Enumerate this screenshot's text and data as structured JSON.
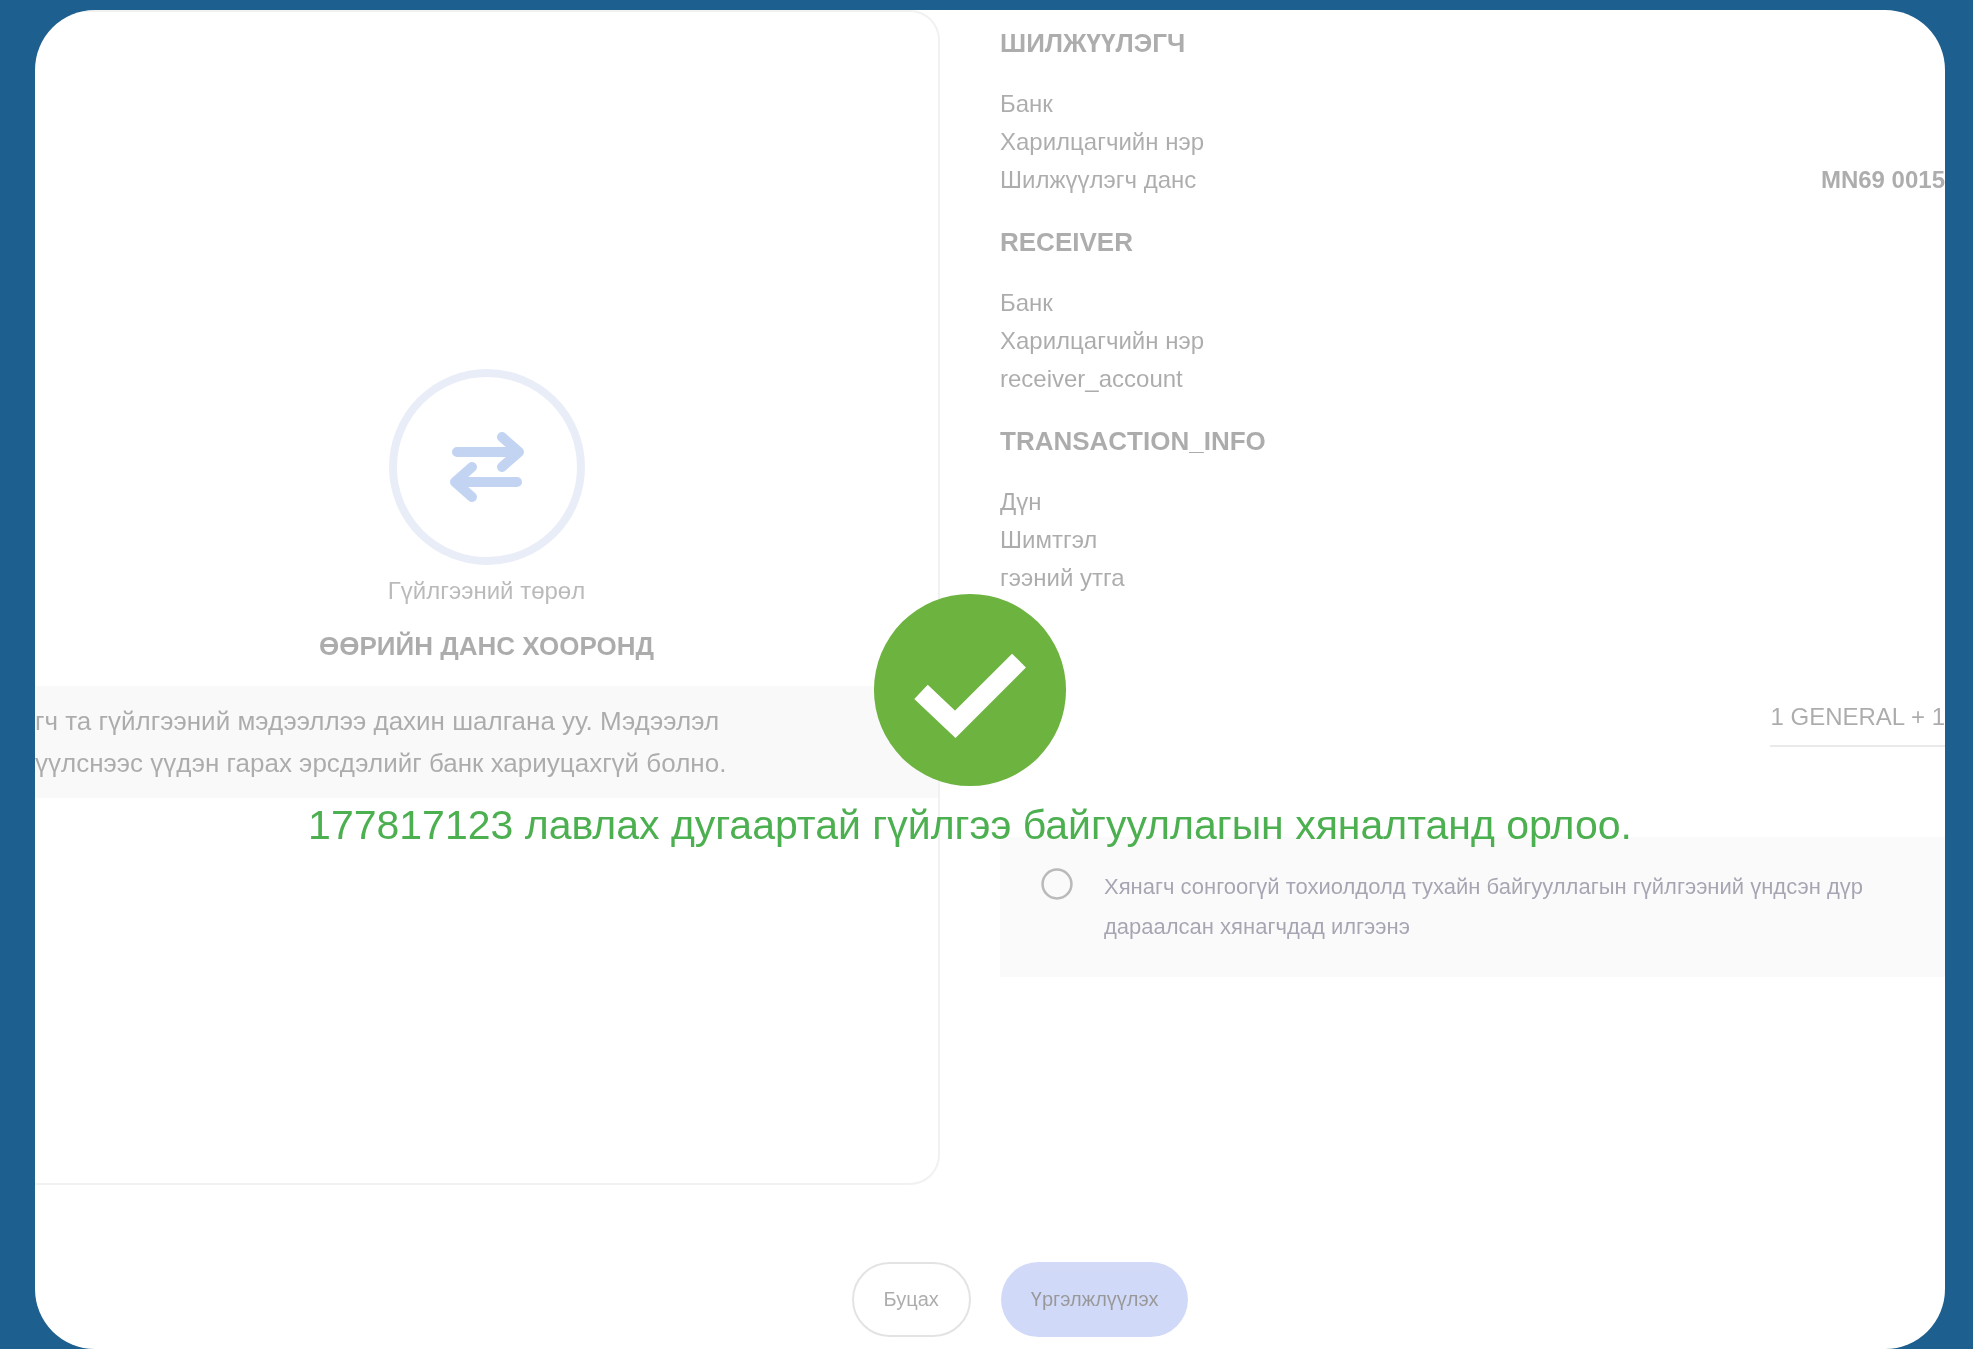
{
  "left_panel": {
    "type_label": "Гүйлгээний төрөл",
    "type_value": "ӨӨРИЙН ДАНС ХООРОНД",
    "warning": [
      "гч та гүйлгээний мэдээллээ дахин шалгана уу. Мэдээлэл",
      "үүлснээс үүдэн гарах эрсдэлийг банк хариуцахгүй болно."
    ]
  },
  "sections": [
    {
      "title": "ШИЛЖҮҮЛЭГЧ",
      "rows": [
        {
          "label": "Банк"
        },
        {
          "label": "Харилцагчийн нэр"
        },
        {
          "label": "Шилжүүлэгч данс",
          "value": "MN69 0015"
        }
      ]
    },
    {
      "title": "RECEIVER",
      "rows": [
        {
          "label": "Банк"
        },
        {
          "label": "Харилцагчийн нэр"
        },
        {
          "label": "receiver_account"
        }
      ]
    },
    {
      "title": "TRANSACTION_INFO",
      "rows": [
        {
          "label": "Дүн"
        },
        {
          "label": "Шимтгэл"
        },
        {
          "label": "гээний утга"
        }
      ]
    }
  ],
  "approval": {
    "value": "1 GENERAL + 1"
  },
  "info_note": [
    "Хянагч сонгоогүй тохиолдолд тухайн байгууллагын гүйлгээний үндсэн дүр",
    "дараалсан хянагчдад илгээнэ"
  ],
  "buttons": [
    {
      "label": "Буцах",
      "kind": "secondary"
    },
    {
      "label": "Үргэлжлүүлэх",
      "kind": "primary"
    }
  ],
  "success": {
    "message": "177817123 лавлах дугаартай гүйлгээ байгууллагын хяналтанд орлоо."
  }
}
